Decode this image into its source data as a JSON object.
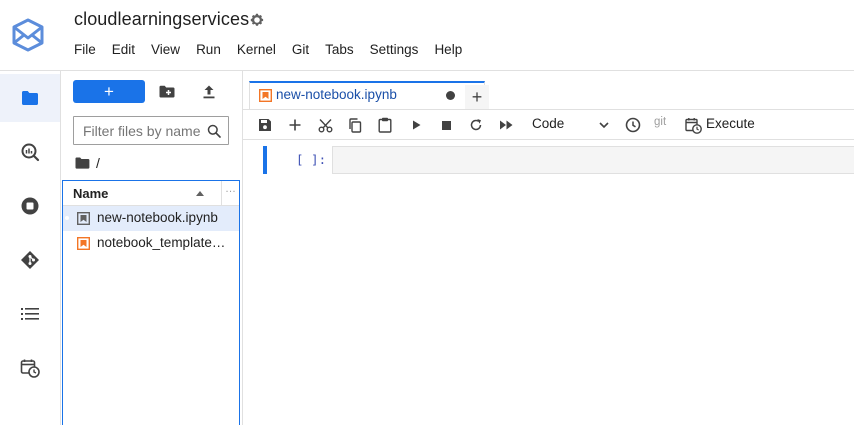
{
  "app": {
    "title": "cloudlearningservices",
    "accent": "#1a73e8",
    "logo_icon": "jupyter-envelope-logo"
  },
  "menubar": {
    "items": [
      "File",
      "Edit",
      "View",
      "Run",
      "Kernel",
      "Git",
      "Tabs",
      "Settings",
      "Help"
    ]
  },
  "activity_bar": {
    "items": [
      {
        "icon": "folder-icon",
        "active": true
      },
      {
        "icon": "search-kernel-icon",
        "active": false
      },
      {
        "icon": "running-stop-icon",
        "active": false
      },
      {
        "icon": "git-icon",
        "active": false
      },
      {
        "icon": "list-icon",
        "active": false
      },
      {
        "icon": "scheduler-icon",
        "active": false
      }
    ]
  },
  "file_browser": {
    "new_label": "+",
    "filter_placeholder": "Filter files by name",
    "breadcrumb": "/",
    "column_name": "Name",
    "column_more": "…",
    "files": [
      {
        "name": "new-notebook.ipynb",
        "selected": true
      },
      {
        "name": "notebook_template.ipynb",
        "selected": false
      }
    ]
  },
  "tabs": [
    {
      "label": "new-notebook.ipynb",
      "unsaved": true
    }
  ],
  "add_tab_label": "+",
  "notebook_toolbar": {
    "cell_type": "Code",
    "git_label": "git",
    "execute_label": "Execute"
  },
  "cell": {
    "prompt": "[ ]:",
    "source": ""
  }
}
